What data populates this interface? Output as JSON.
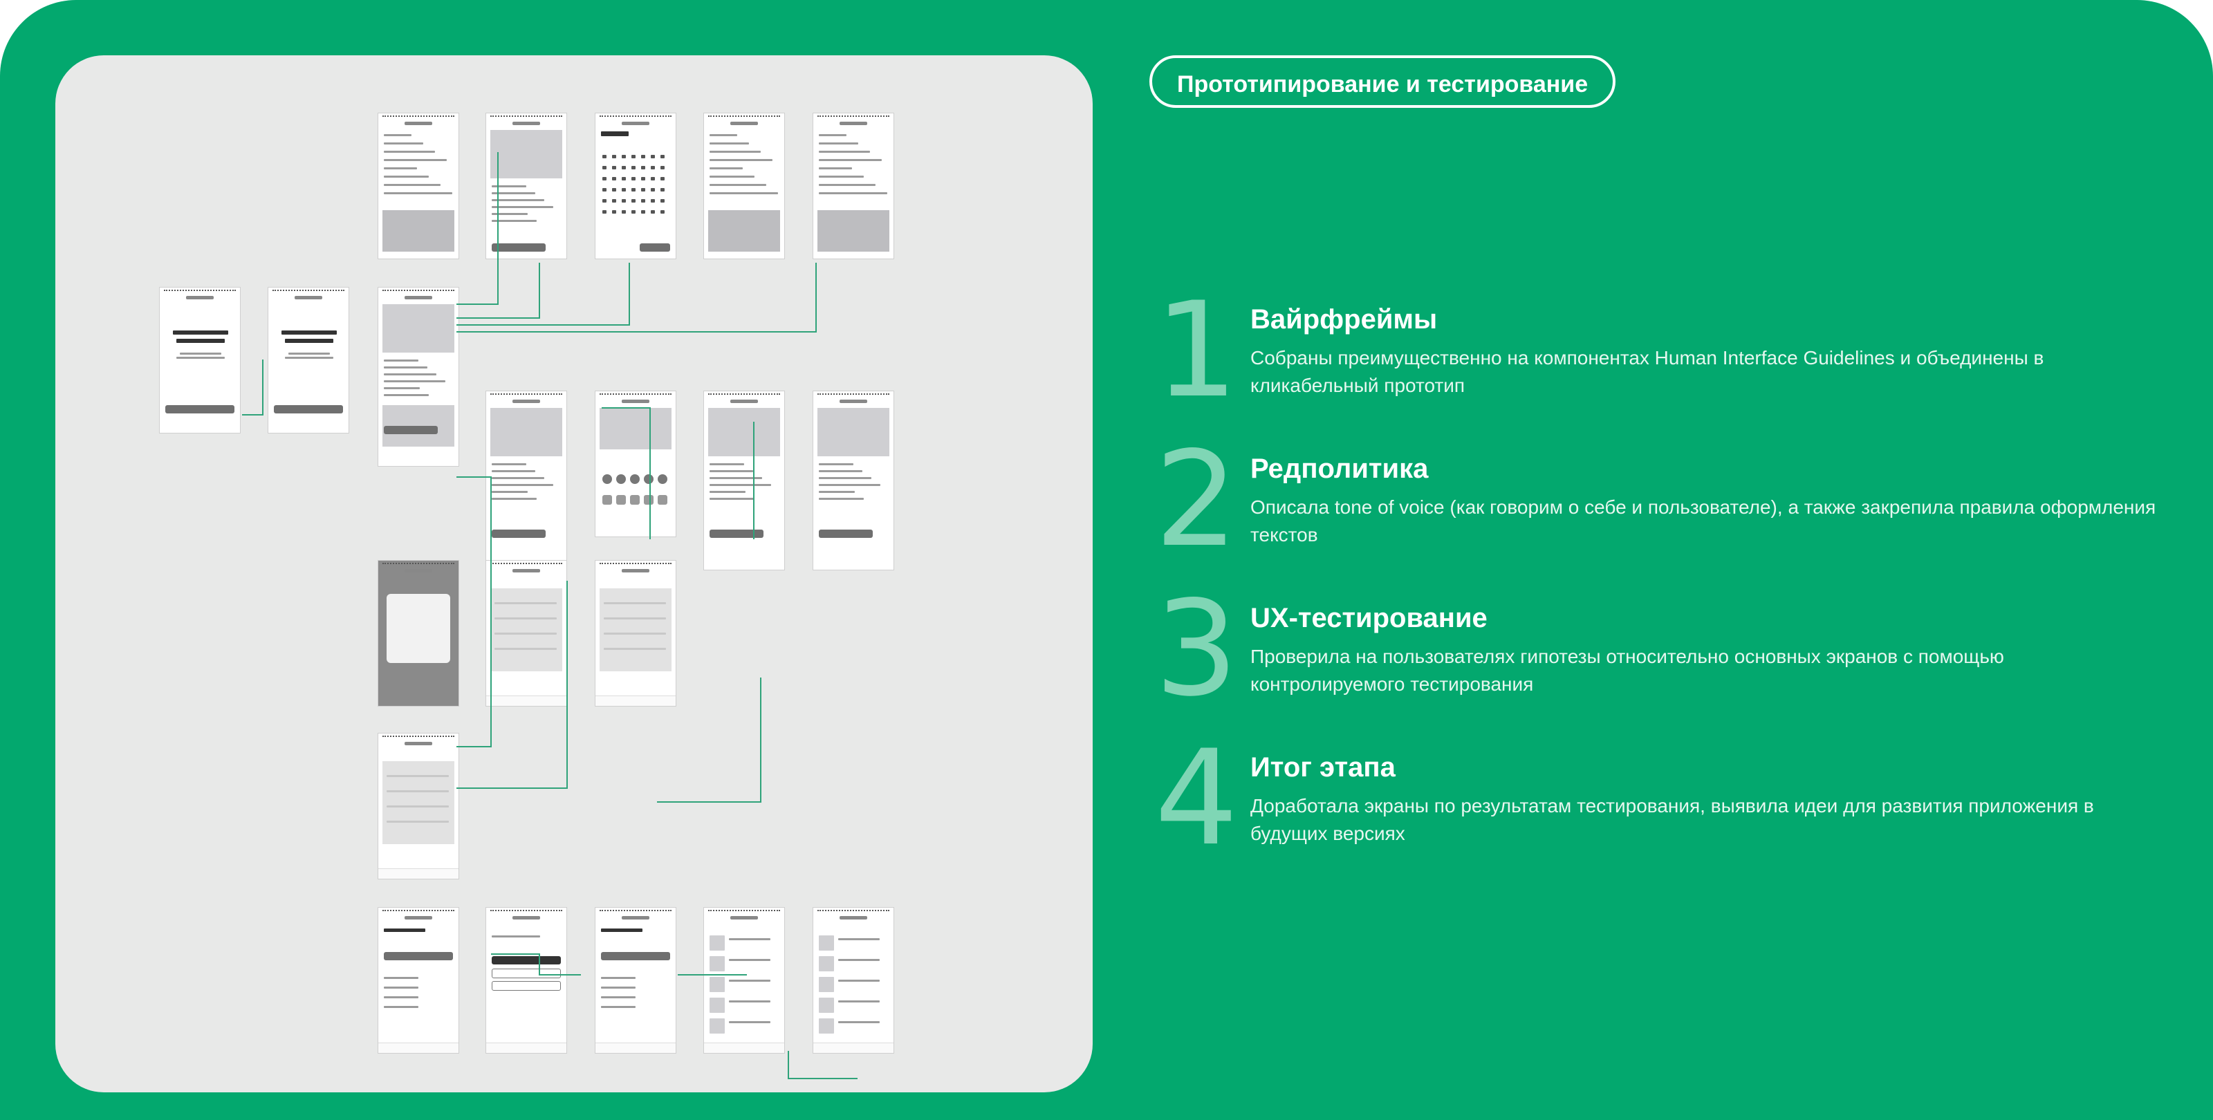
{
  "header": {
    "badge": "Прототипирование и тестирование"
  },
  "steps": [
    {
      "num": "1",
      "title": "Вайрфреймы",
      "desc": "Собраны преимущественно на компонентах Human Interface Guidelines и объединены в кликабельный прототип"
    },
    {
      "num": "2",
      "title": "Редполитика",
      "desc": "Описала tone of voice (как говорим о себе и пользователе), а также закрепила правила оформления текстов"
    },
    {
      "num": "3",
      "title": "UX-тестирование",
      "desc": "Проверила на пользователях гипотезы относительно основных экранов с помощью контролируемого тестирования"
    },
    {
      "num": "4",
      "title": "Итог этапа",
      "desc": "Доработала экраны по результатам тестирования, выявила идеи для развития приложения в будущих версиях"
    }
  ],
  "colors": {
    "background": "#03a86e",
    "board": "#e8e9e8",
    "number": "#7fd6b5",
    "wire": "#2fa37a"
  }
}
